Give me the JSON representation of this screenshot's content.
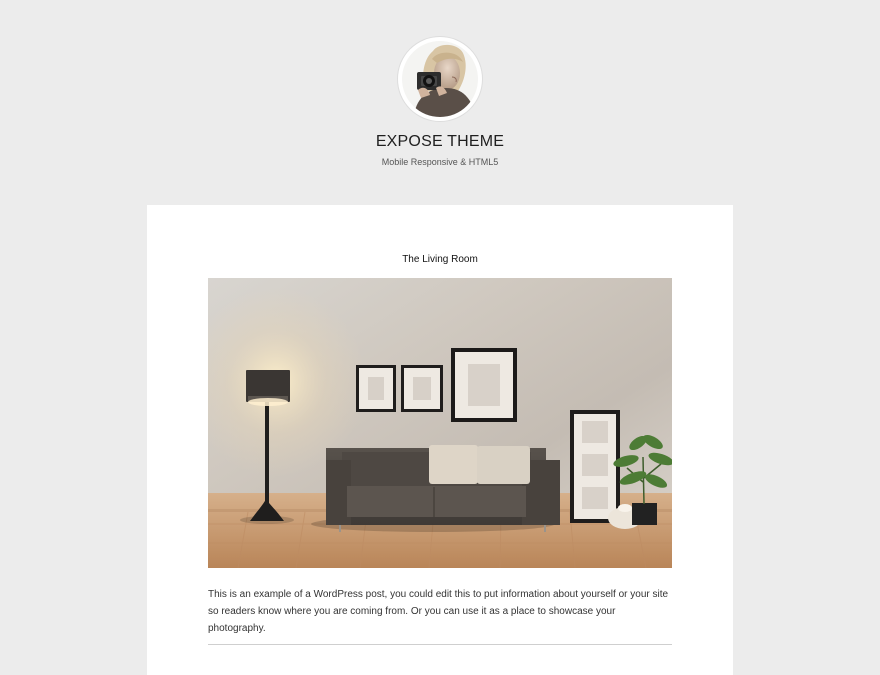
{
  "site": {
    "title": "EXPOSE THEME",
    "tagline": "Mobile Responsive & HTML5",
    "avatar_icon": "photographer-avatar-icon"
  },
  "post": {
    "title": "The Living Room",
    "image_icon": "living-room-photo",
    "excerpt": "This is an example of a WordPress post, you could edit this to put information about yourself or your site so readers know where you are coming from. Or you can use it as a place to showcase your photography."
  },
  "colors": {
    "page_background": "#ececec",
    "card_background": "#ffffff",
    "title_text": "#1f1f1f",
    "body_text": "#333333",
    "divider": "#cfcfcf"
  }
}
